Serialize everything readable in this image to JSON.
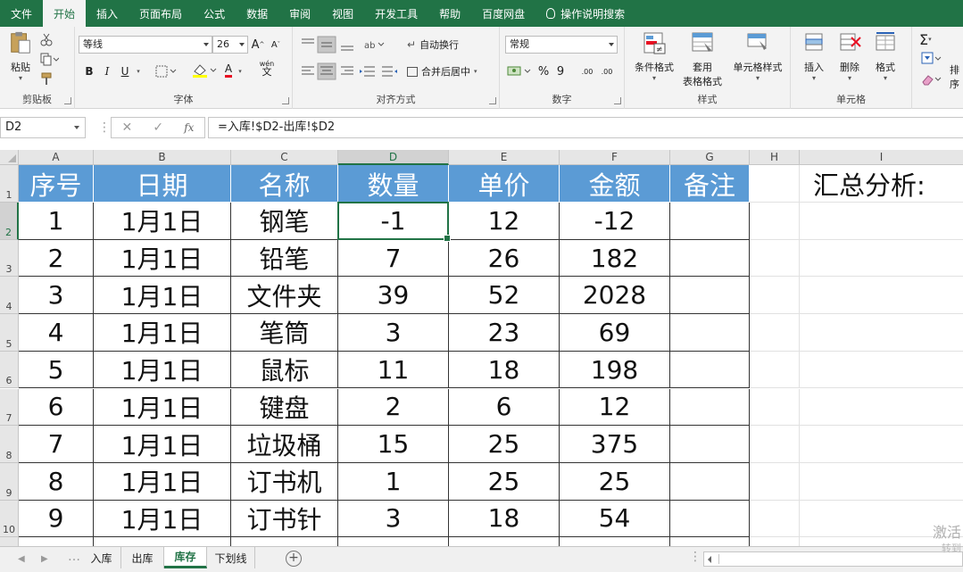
{
  "tabs": [
    "文件",
    "开始",
    "插入",
    "页面布局",
    "公式",
    "数据",
    "审阅",
    "视图",
    "开发工具",
    "帮助",
    "百度网盘"
  ],
  "active_tab": "开始",
  "tell_me": "操作说明搜索",
  "ribbon": {
    "clipboard": {
      "paste": "粘贴",
      "label": "剪贴板"
    },
    "font": {
      "name": "等线",
      "size": "26",
      "bold": "B",
      "italic": "I",
      "underline": "U",
      "grow": "A",
      "shrink": "A",
      "font_color": "A",
      "phonetic": "wén",
      "label": "字体"
    },
    "alignment": {
      "wrap": "自动换行",
      "merge": "合并后居中",
      "label": "对齐方式"
    },
    "number": {
      "format": "常规",
      "percent": "%",
      "comma": "9",
      "inc_decimal": ".00",
      "dec_decimal": ".00",
      "label": "数字"
    },
    "styles": {
      "conditional": "条件格式",
      "table_line1": "套用",
      "table_line2": "表格格式",
      "cell_styles": "单元格样式",
      "label": "样式"
    },
    "cells": {
      "insert": "插入",
      "delete": "删除",
      "format": "格式",
      "label": "单元格"
    },
    "editing": {
      "sum": "Σ",
      "sort": "排序"
    }
  },
  "formula_bar": {
    "name_box": "D2",
    "formula": "=入库!$D2-出库!$D2",
    "fx": "fx"
  },
  "columns": [
    "A",
    "B",
    "C",
    "D",
    "E",
    "F",
    "G",
    "H",
    "I"
  ],
  "rows": [
    "1",
    "2",
    "3",
    "4",
    "5",
    "6",
    "7",
    "8",
    "9",
    "10"
  ],
  "table": {
    "headers": [
      "序号",
      "日期",
      "名称",
      "数量",
      "单价",
      "金额",
      "备注"
    ],
    "rows": [
      [
        "1",
        "1月1日",
        "钢笔",
        "-1",
        "12",
        "-12",
        ""
      ],
      [
        "2",
        "1月1日",
        "铅笔",
        "7",
        "26",
        "182",
        ""
      ],
      [
        "3",
        "1月1日",
        "文件夹",
        "39",
        "52",
        "2028",
        ""
      ],
      [
        "4",
        "1月1日",
        "笔筒",
        "3",
        "23",
        "69",
        ""
      ],
      [
        "5",
        "1月1日",
        "鼠标",
        "11",
        "18",
        "198",
        ""
      ],
      [
        "6",
        "1月1日",
        "键盘",
        "2",
        "6",
        "12",
        ""
      ],
      [
        "7",
        "1月1日",
        "垃圾桶",
        "15",
        "25",
        "375",
        ""
      ],
      [
        "8",
        "1月1日",
        "订书机",
        "1",
        "25",
        "25",
        ""
      ],
      [
        "9",
        "1月1日",
        "订书针",
        "3",
        "18",
        "54",
        ""
      ]
    ]
  },
  "summary_label": "汇总分析:",
  "sheets": [
    "入库",
    "出库",
    "库存",
    "下划线"
  ],
  "active_sheet": "库存",
  "watermark": "激活",
  "watermark_sub": "转到"
}
